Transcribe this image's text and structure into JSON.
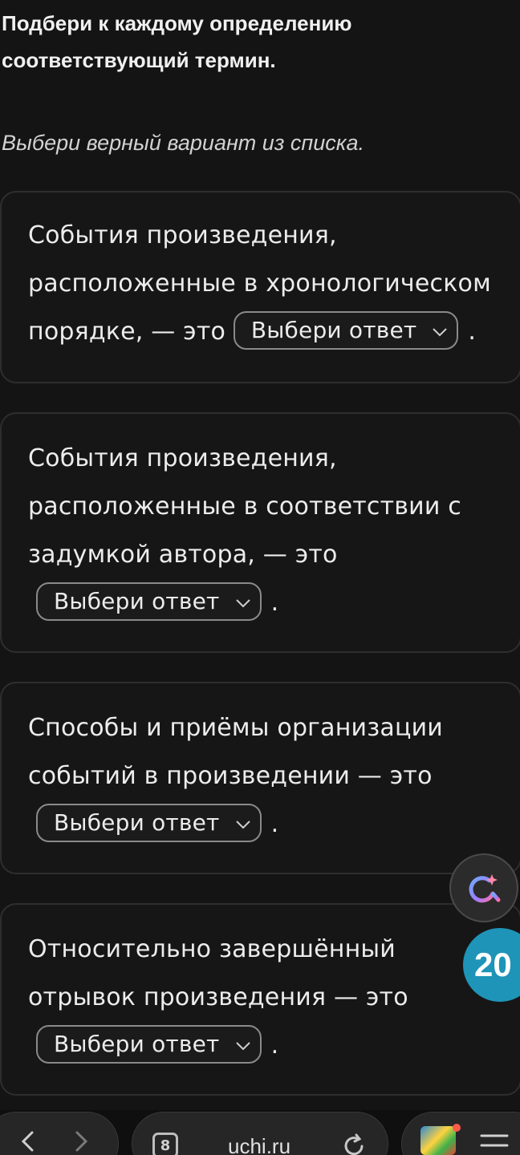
{
  "task": {
    "title": "Подбери к каждому определению соответствующий термин.",
    "instruction": "Выбери верный вариант из списка."
  },
  "questions": [
    {
      "text": "События произведения, расположенные в хронологическом порядке, — это",
      "select_placeholder": "Выбери ответ",
      "end": "."
    },
    {
      "text": "События произведения, расположенные в соответствии с задумкой автора, — это",
      "select_placeholder": "Выбери ответ",
      "end": "."
    },
    {
      "text": "Способы и приёмы организации событий в произведении — это",
      "select_placeholder": "Выбери ответ",
      "end": "."
    },
    {
      "text": "Относительно завершённый отрывок произведения — это",
      "select_placeholder": "Выбери ответ",
      "end": "."
    }
  ],
  "floating": {
    "ai_icon": "ai-assistant-icon",
    "counter_badge": "20"
  },
  "browser": {
    "tabs_count": "8",
    "url": "uchi.ru",
    "back_icon": "chevron-left-icon",
    "forward_icon": "chevron-right-icon",
    "reload_icon": "reload-icon",
    "menu_icon": "menu-icon"
  },
  "colors": {
    "background": "#141414",
    "card_border": "#2e2e2e",
    "badge": "#1e94b8"
  }
}
